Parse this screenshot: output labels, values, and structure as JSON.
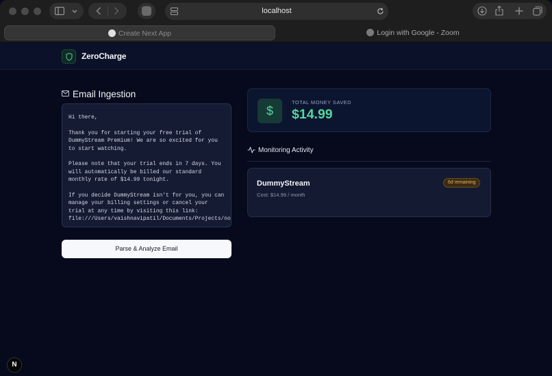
{
  "browser": {
    "url": "localhost",
    "tabs": [
      {
        "label": "Create Next App",
        "active": true
      },
      {
        "label": "Login with Google - Zoom",
        "active": false
      }
    ]
  },
  "app": {
    "name": "ZeroCharge"
  },
  "ingestion": {
    "title": "Email Ingestion",
    "email_body": "Hi there,\n\nThank you for starting your free trial of DummyStream Premium! We are so excited for you to start watching.\n\nPlease note that your trial ends in 7 days. You will automatically be billed our standard monthly rate of $14.99 tonight.\n\nIf you decide DummyStream isn't for you, you can manage your billing settings or cancel your trial at any time by visiting this link: file:///Users/vaishnavipatil/Documents/Projects/nova/dummystream/index.html",
    "parse_button": "Parse & Analyze Email"
  },
  "savings": {
    "label": "TOTAL MONEY SAVED",
    "value": "$14.99",
    "icon": "$"
  },
  "activity": {
    "title": "Monitoring Activity",
    "items": [
      {
        "name": "DummyStream",
        "cost": "Cost: $14.99 / month",
        "badge": "6d remaining"
      }
    ]
  },
  "colors": {
    "accent": "#52d89d",
    "badge": "#e7b65e",
    "background": "#060a1c"
  }
}
